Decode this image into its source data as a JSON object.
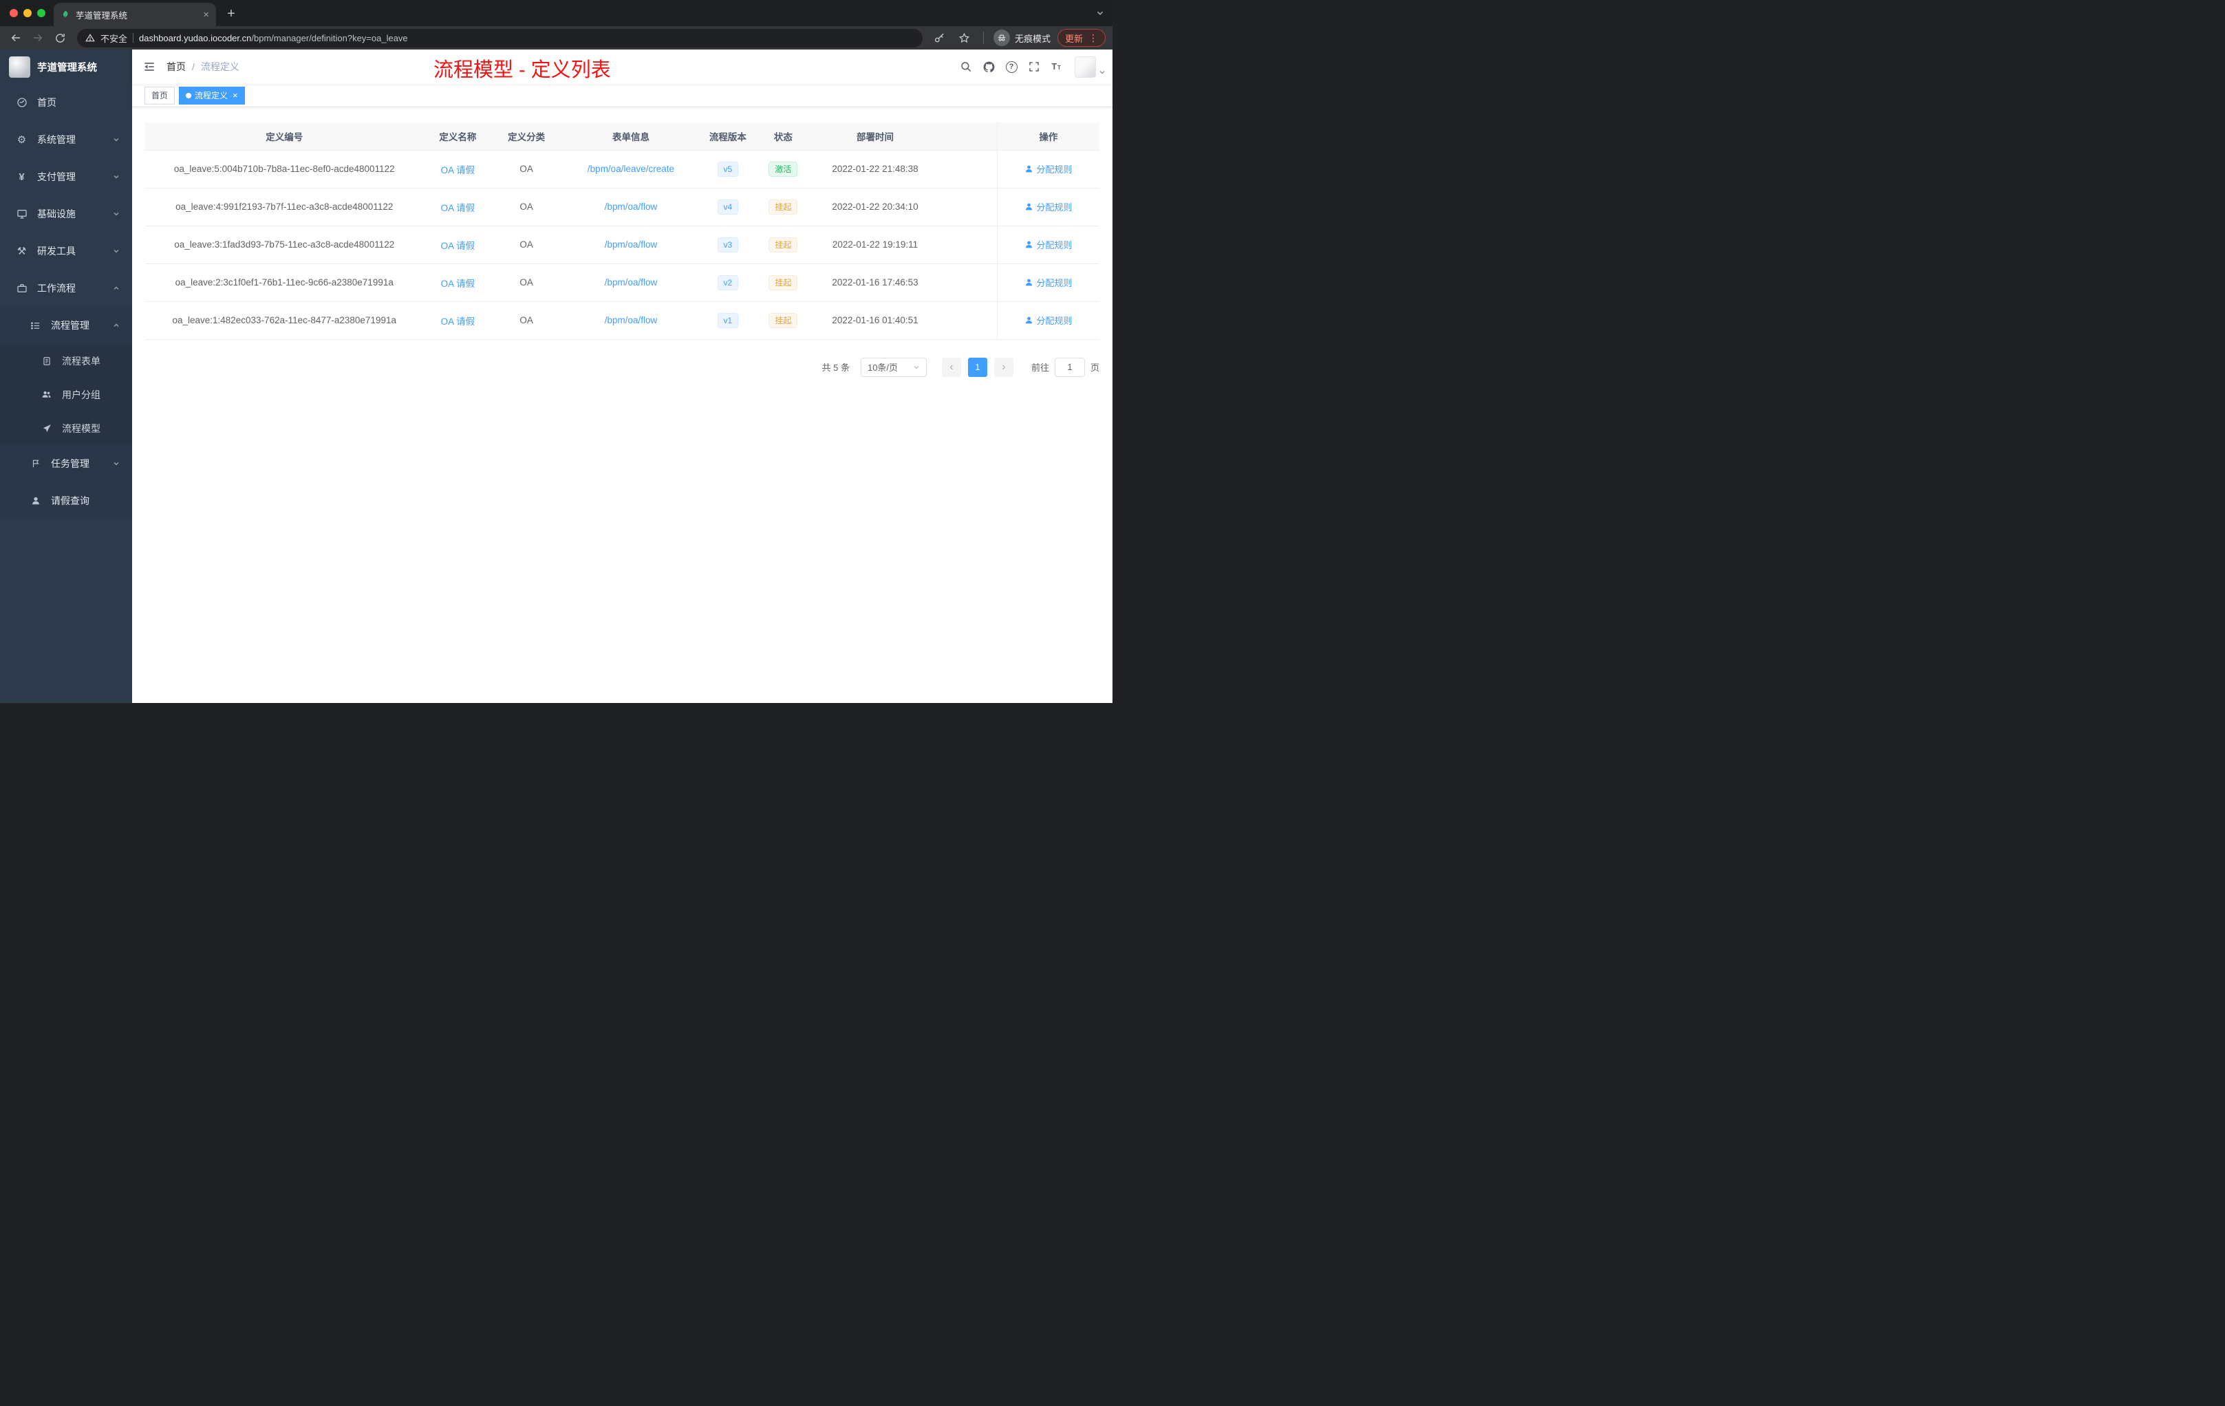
{
  "colors": {
    "accent_blue": "#409eff",
    "annotation_red": "#f31111",
    "status_green": "#1fba67",
    "status_orange": "#e6a23c",
    "sidebar_bg": "#2d3a4b"
  },
  "browser": {
    "tab_title": "芋道管理系统",
    "security_label": "不安全",
    "url_host": "dashboard.yudao.iocoder.cn",
    "url_path": "/bpm/manager/definition?key=oa_leave",
    "incognito_label": "无痕模式",
    "update_label": "更新"
  },
  "sidebar": {
    "logo_title": "芋道管理系统",
    "menu": [
      {
        "label": "首页",
        "icon": "dashboard-icon"
      },
      {
        "label": "系统管理",
        "icon": "gear-icon",
        "arrow": "down"
      },
      {
        "label": "支付管理",
        "icon": "yen-icon",
        "arrow": "down"
      },
      {
        "label": "基础设施",
        "icon": "monitor-icon",
        "arrow": "down"
      },
      {
        "label": "研发工具",
        "icon": "tools-icon",
        "arrow": "down"
      },
      {
        "label": "工作流程",
        "icon": "briefcase-icon",
        "arrow": "up"
      },
      {
        "label": "流程管理",
        "icon": "list-icon",
        "arrow": "up"
      },
      {
        "label": "流程表单",
        "icon": "form-icon"
      },
      {
        "label": "用户分组",
        "icon": "user-group-icon"
      },
      {
        "label": "流程模型",
        "icon": "send-icon"
      },
      {
        "label": "任务管理",
        "icon": "task-icon",
        "arrow": "down"
      },
      {
        "label": "请假查询",
        "icon": "user-icon"
      }
    ]
  },
  "header": {
    "breadcrumb_home": "首页",
    "breadcrumb_current": "流程定义",
    "annotation": "流程模型 - 定义列表"
  },
  "tags": [
    {
      "label": "首页"
    },
    {
      "label": "流程定义"
    }
  ],
  "table": {
    "columns": [
      "定义编号",
      "定义名称",
      "定义分类",
      "表单信息",
      "流程版本",
      "状态",
      "部署时间",
      "操作"
    ],
    "rows": [
      {
        "id": "oa_leave:5:004b710b-7b8a-11ec-8ef0-acde48001122",
        "name": "OA 请假",
        "category": "OA",
        "form": "/bpm/oa/leave/create",
        "version": "v5",
        "status": "激活",
        "status_type": "active",
        "time": "2022-01-22 21:48:38",
        "action": "分配规则"
      },
      {
        "id": "oa_leave:4:991f2193-7b7f-11ec-a3c8-acde48001122",
        "name": "OA 请假",
        "category": "OA",
        "form": "/bpm/oa/flow",
        "version": "v4",
        "status": "挂起",
        "status_type": "suspended",
        "time": "2022-01-22 20:34:10",
        "action": "分配规则"
      },
      {
        "id": "oa_leave:3:1fad3d93-7b75-11ec-a3c8-acde48001122",
        "name": "OA 请假",
        "category": "OA",
        "form": "/bpm/oa/flow",
        "version": "v3",
        "status": "挂起",
        "status_type": "suspended",
        "time": "2022-01-22 19:19:11",
        "action": "分配规则"
      },
      {
        "id": "oa_leave:2:3c1f0ef1-76b1-11ec-9c66-a2380e71991a",
        "name": "OA 请假",
        "category": "OA",
        "form": "/bpm/oa/flow",
        "version": "v2",
        "status": "挂起",
        "status_type": "suspended",
        "time": "2022-01-16 17:46:53",
        "action": "分配规则"
      },
      {
        "id": "oa_leave:1:482ec033-762a-11ec-8477-a2380e71991a",
        "name": "OA 请假",
        "category": "OA",
        "form": "/bpm/oa/flow",
        "version": "v1",
        "status": "挂起",
        "status_type": "suspended",
        "time": "2022-01-16 01:40:51",
        "action": "分配规则"
      }
    ]
  },
  "pagination": {
    "total": "共 5 条",
    "page_size": "10条/页",
    "current_page": "1",
    "goto_label": "前往",
    "goto_value": "1",
    "goto_unit": "页"
  }
}
